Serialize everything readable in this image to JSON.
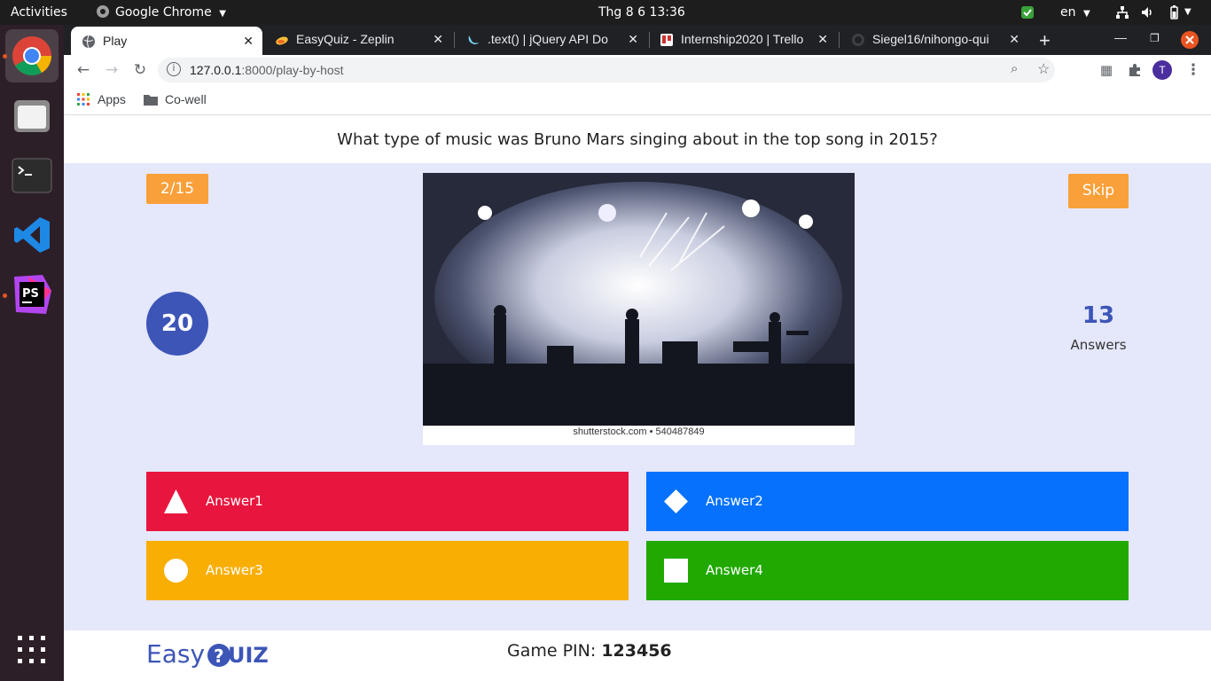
{
  "topbar": {
    "activities": "Activities",
    "app_name": "Google Chrome",
    "clock": "Thg 8 6  13:36",
    "language": "en"
  },
  "tabs": [
    {
      "title": "Play",
      "active": true
    },
    {
      "title": "EasyQuiz - Zeplin"
    },
    {
      "title": ".text() | jQuery API Do"
    },
    {
      "title": "Internship2020 | Trello"
    },
    {
      "title": "Siegel16/nihongo-qui"
    }
  ],
  "address_bar": {
    "host": "127.0.0.1",
    "path": ":8000/play-by-host"
  },
  "bookmarks": [
    {
      "label": "Apps",
      "icon": "apps-grid-icon"
    },
    {
      "label": "Co-well",
      "icon": "folder-icon"
    }
  ],
  "quiz": {
    "question": "What type of music was Bruno Mars singing about in the top song in 2015?",
    "progress": "2/15",
    "skip_label": "Skip",
    "timer": "20",
    "answer_count": "13",
    "answers_label": "Answers",
    "image_caption": "shutterstock.com • 540487849",
    "answers": [
      {
        "label": "Answer1",
        "shape": "triangle-icon",
        "color": "#e8163e"
      },
      {
        "label": "Answer2",
        "shape": "diamond-icon",
        "color": "#0571fd"
      },
      {
        "label": "Answer3",
        "shape": "circle-icon",
        "color": "#f9ae03"
      },
      {
        "label": "Answer4",
        "shape": "square-icon",
        "color": "#21a902"
      }
    ]
  },
  "footer": {
    "logo_text": "EasyQUIZ",
    "pin_label": "Game PIN:",
    "pin_value": "123456"
  },
  "colors": {
    "accent_orange": "#f9a03a",
    "accent_blue": "#3d55b7",
    "stage_bg": "#e5e7fb"
  }
}
